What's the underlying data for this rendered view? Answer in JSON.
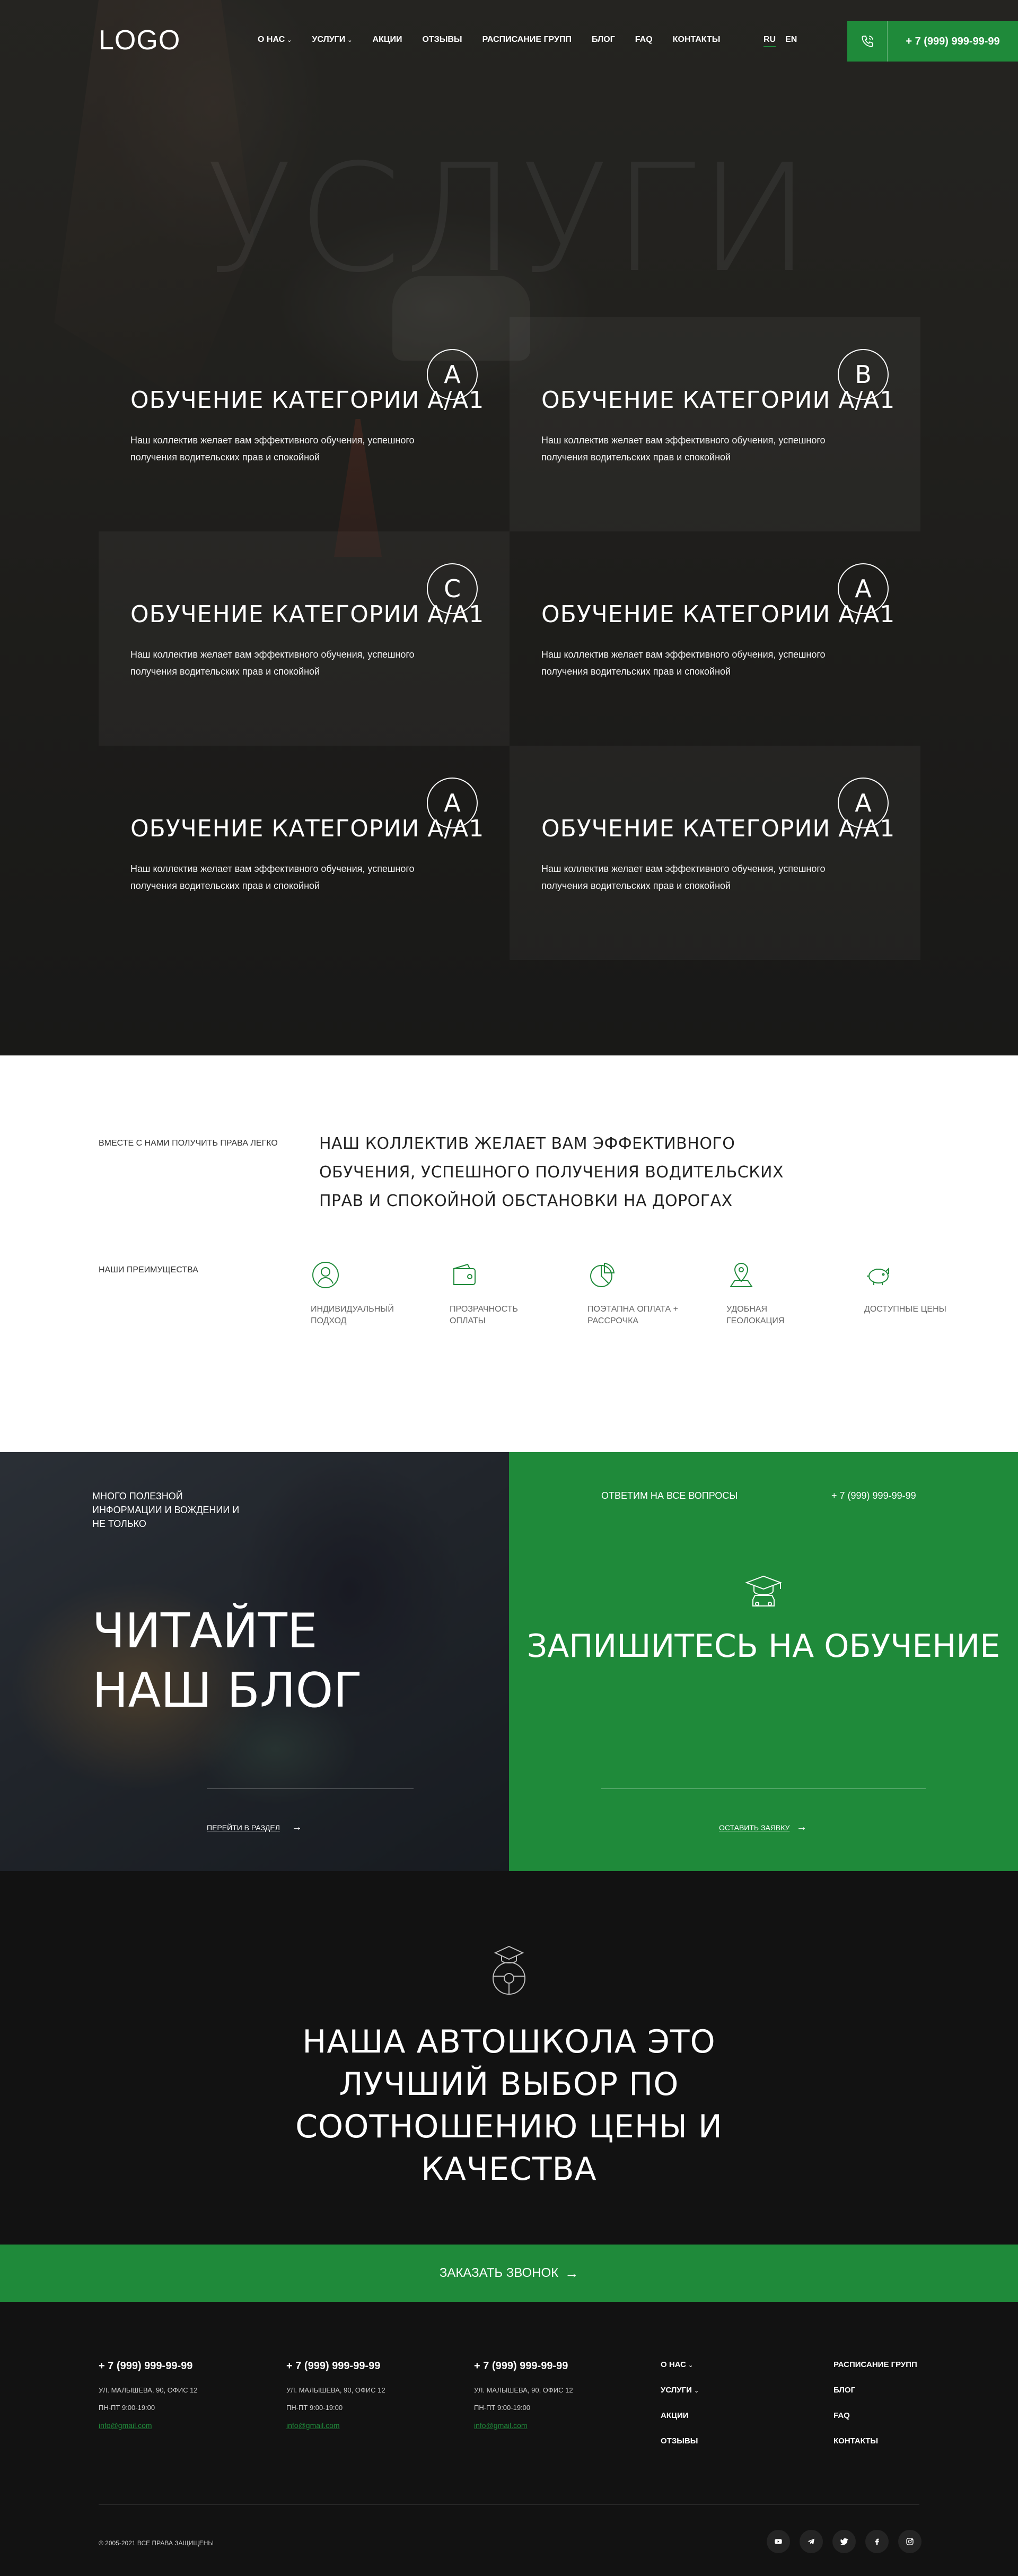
{
  "header": {
    "logo": "LOGO",
    "nav": [
      {
        "label": "О НАС",
        "dropdown": true
      },
      {
        "label": "УСЛУГИ",
        "dropdown": true
      },
      {
        "label": "АКЦИИ",
        "dropdown": false
      },
      {
        "label": "ОТЗЫВЫ",
        "dropdown": false
      },
      {
        "label": "РАСПИСАНИЕ ГРУПП",
        "dropdown": false
      },
      {
        "label": "БЛОГ",
        "dropdown": false
      },
      {
        "label": "FAQ",
        "dropdown": false
      },
      {
        "label": "КОНТАКТЫ",
        "dropdown": false
      }
    ],
    "langs": {
      "active": "RU",
      "other": "EN"
    },
    "phone": "+ 7 (999) 999-99-99",
    "phone_icon": "phone-icon"
  },
  "hero": {
    "watermark": "УСЛУГИ",
    "services": [
      {
        "title": "ОБУЧЕНИЕ КАТЕГОРИИ А/А1",
        "desc": "Наш коллектив желает вам эффективного обучения, успешного получения водительских прав и спокойной",
        "badge": "A"
      },
      {
        "title": "ОБУЧЕНИЕ КАТЕГОРИИ А/А1",
        "desc": "Наш коллектив желает вам эффективного обучения, успешного получения водительских прав и спокойной",
        "badge": "B"
      },
      {
        "title": "ОБУЧЕНИЕ КАТЕГОРИИ А/А1",
        "desc": "Наш коллектив желает вам эффективного обучения, успешного получения водительских прав и спокойной",
        "badge": "C"
      },
      {
        "title": "ОБУЧЕНИЕ КАТЕГОРИИ А/А1",
        "desc": "Наш коллектив желает вам эффективного обучения, успешного получения водительских прав и спокойной",
        "badge": "A"
      },
      {
        "title": "ОБУЧЕНИЕ КАТЕГОРИИ А/А1",
        "desc": "Наш коллектив желает вам эффективного обучения, успешного получения водительских прав и спокойной",
        "badge": "A"
      },
      {
        "title": "ОБУЧЕНИЕ КАТЕГОРИИ А/А1",
        "desc": "Наш коллектив желает вам эффективного обучения, успешного получения водительских прав и спокойной",
        "badge": "A"
      }
    ]
  },
  "about": {
    "label": "ВМЕСТЕ С НАМИ ПОЛУЧИТЬ ПРАВА ЛЕГКО",
    "text": "НАШ КОЛЛЕКТИВ ЖЕЛАЕТ ВАМ ЭФФЕКТИВНОГО ОБУЧЕНИЯ, УСПЕШНОГО ПОЛУЧЕНИЯ ВОДИТЕЛЬСКИХ ПРАВ И СПОКОЙНОЙ ОБСТАНОВКИ НА ДОРОГАХ",
    "advantages_label": "НАШИ ПРЕИМУЩЕСТВА",
    "advantages": [
      {
        "icon": "user-icon",
        "label": "ИНДИВИДУАЛЬНЫЙ ПОДХОД"
      },
      {
        "icon": "wallet-icon",
        "label": "ПРОЗРАЧНОСТЬ ОПЛАТЫ"
      },
      {
        "icon": "pie-chart-icon",
        "label": "ПОЭТАПНА ОПЛАТА + РАССРОЧКА"
      },
      {
        "icon": "map-pin-icon",
        "label": "УДОБНАЯ ГЕОЛОКАЦИЯ"
      },
      {
        "icon": "piggy-bank-icon",
        "label": "ДОСТУПНЫЕ ЦЕНЫ"
      }
    ]
  },
  "blog": {
    "kicker": "МНОГО ПОЛЕЗНОЙ ИНФОРМАЦИИ И ВОЖДЕНИИ И НЕ ТОЛЬКО",
    "title": "ЧИТАЙТЕ НАШ БЛОГ",
    "link": "ПЕРЕЙТИ В РАЗДЕЛ"
  },
  "signup": {
    "question": "ОТВЕТИМ НА ВСЕ ВОПРОСЫ",
    "phone": "+ 7 (999) 999-99-99",
    "icon": "graduation-car-icon",
    "title": "ЗАПИШИТЕСЬ НА ОБУЧЕНИЕ",
    "link": "ОСТАВИТЬ ЗАЯВКУ"
  },
  "tagline": {
    "icon": "graduation-wheel-icon",
    "title": "НАША АВТОШКОЛА ЭТО ЛУЧШИЙ ВЫБОР ПО СООТНОШЕНИЮ ЦЕНЫ И КАЧЕСТВА"
  },
  "cta": {
    "label": "ЗАКАЗАТЬ ЗВОНОК"
  },
  "footer": {
    "contacts": [
      {
        "phone": "+ 7 (999) 999-99-99",
        "address": "УЛ. МАЛЫШЕВА, 90, ОФИС 12",
        "hours": "ПН-ПТ 9:00-19:00",
        "email": "info@gmail.com"
      },
      {
        "phone": "+ 7 (999) 999-99-99",
        "address": "УЛ. МАЛЫШЕВА, 90, ОФИС 12",
        "hours": "ПН-ПТ 9:00-19:00",
        "email": "info@gmail.com"
      },
      {
        "phone": "+ 7 (999) 999-99-99",
        "address": "УЛ. МАЛЫШЕВА, 90, ОФИС 12",
        "hours": "ПН-ПТ 9:00-19:00",
        "email": "info@gmail.com"
      }
    ],
    "menu1": [
      {
        "label": "О НАС",
        "dropdown": true
      },
      {
        "label": "УСЛУГИ",
        "dropdown": true
      },
      {
        "label": "АКЦИИ",
        "dropdown": false
      },
      {
        "label": "ОТЗЫВЫ",
        "dropdown": false
      }
    ],
    "menu2": [
      "РАСПИСАНИЕ ГРУПП",
      "БЛОГ",
      "FAQ",
      "КОНТАКТЫ"
    ],
    "copyright": "© 2005-2021 ВСЕ ПРАВА ЗАЩИЩЕНЫ",
    "socials": [
      "youtube-icon",
      "telegram-icon",
      "twitter-icon",
      "facebook-icon",
      "instagram-icon"
    ]
  },
  "colors": {
    "accent": "#1f8a3a",
    "dark": "#121212",
    "white": "#ffffff"
  }
}
